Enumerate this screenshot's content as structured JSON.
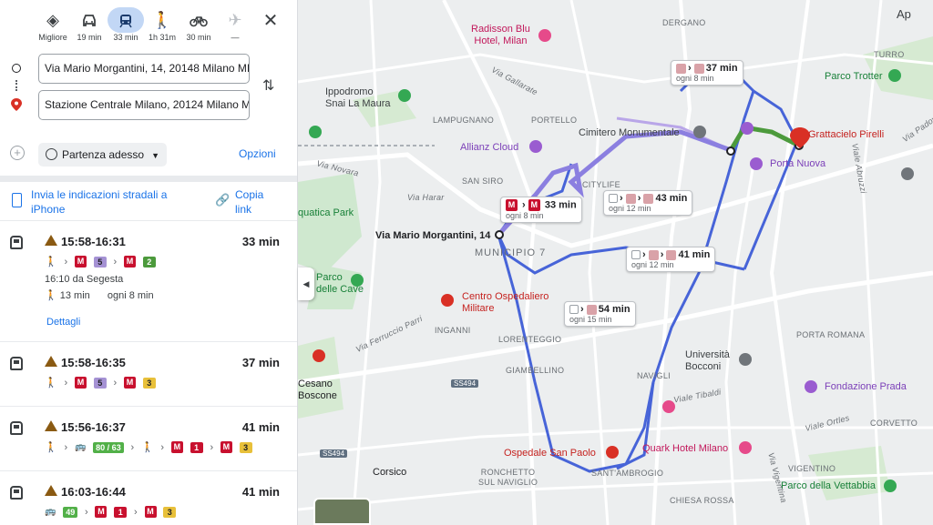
{
  "modes": [
    {
      "id": "best",
      "label": "Migliore",
      "icon": "diamond-turn-icon"
    },
    {
      "id": "car",
      "label": "19 min",
      "icon": "car-icon"
    },
    {
      "id": "transit",
      "label": "33 min",
      "icon": "train-icon",
      "active": true
    },
    {
      "id": "walk",
      "label": "1h 31m",
      "icon": "walk-icon"
    },
    {
      "id": "bike",
      "label": "30 min",
      "icon": "bike-icon"
    },
    {
      "id": "flight",
      "label": "—",
      "icon": "plane-icon"
    }
  ],
  "origin": "Via Mario Morgantini, 14, 20148 Milano MI",
  "destination": "Stazione Centrale Milano, 20124 Milano MI",
  "depart_label": "Partenza adesso",
  "options_label": "Opzioni",
  "send_label": "Invia le indicazioni stradali a iPhone",
  "copy_label": "Copia link",
  "details_label": "Dettagli",
  "routes": [
    {
      "time": "15:58-16:31",
      "duration": "33 min",
      "lines": [
        "5",
        "2"
      ],
      "info1": "16:10 da Segesta",
      "walk_time": "13 min",
      "freq": "ogni 8 min"
    },
    {
      "time": "15:58-16:35",
      "duration": "37 min",
      "lines": [
        "5",
        "3"
      ]
    },
    {
      "time": "15:56-16:37",
      "duration": "41 min",
      "bus": "80 / 63",
      "lines": [
        "1",
        "3"
      ]
    },
    {
      "time": "16:03-16:44",
      "duration": "41 min",
      "bus": "49",
      "lines": [
        "1",
        "3"
      ]
    }
  ],
  "map": {
    "origin_label": "Via Mario Morgantini, 14",
    "districts": {
      "dergano": "DERGANO",
      "turro": "TURRO",
      "lampugnano": "LAMPUGNANO",
      "portello": "PORTELLO",
      "san_siro": "SAN SIRO",
      "citylife": "CITYLIFE",
      "municipio": "MUNICIPIO 7",
      "inganni": "INGANNI",
      "lorenteggio": "LORENTEGGIO",
      "giambellino": "GIAMBELLINO",
      "navigli": "NAVIGLI",
      "porta_romana": "PORTA ROMANA",
      "corvetto": "CORVETTO",
      "ronchetto": "RONCHETTO\nSUL NAVIGLIO",
      "santambrogio": "SANT'AMBROGIO",
      "chiesa_rossa": "CHIESA ROSSA",
      "vigentino": "VIGENTINO"
    },
    "towns": {
      "corsico": "Corsico",
      "cesano": "Cesano\nBoscone"
    },
    "pois": {
      "radisson": "Radisson Blu\nHotel, Milan",
      "ippodromo": "Ippodromo\nSnai La Maura",
      "allianz": "Allianz Cloud",
      "cimitero": "Cimitero Monumentale",
      "pirelli": "Grattacielo Pirelli",
      "porta_nuova": "Porta Nuova",
      "parco_trotter": "Parco Trotter",
      "aquatica": "quatica Park",
      "parco_cave": "Parco\ndelle Cave",
      "ospedaliero": "Centro Ospedaliero\nMilitare",
      "bocconi": "Università\nBocconi",
      "fondazione": "Fondazione Prada",
      "ospedale_sp": "Ospedale San Paolo",
      "quark": "Quark Hotel Milano",
      "vettabbia": "Parco della Vettabbia"
    },
    "streets": {
      "gallarate": "Via Gallarate",
      "novara": "Via Novara",
      "harar": "Via Harar",
      "parri": "Via Ferruccio Parri",
      "tibaldi": "Viale Tibaldi",
      "ortles": "Viale Ortles",
      "vigentina": "Via Vigentina",
      "padova": "Via Padova",
      "abruzzi": "Viale Abruzzi"
    },
    "shields": {
      "ss494a": "SS494",
      "ss494b": "SS494"
    },
    "apps_label": "Ap",
    "tags": [
      {
        "dur": "33 min",
        "freq": "ogni 8 min"
      },
      {
        "dur": "37 min",
        "freq": "ogni 8 min"
      },
      {
        "dur": "43 min",
        "freq": "ogni 12 min"
      },
      {
        "dur": "41 min",
        "freq": "ogni 12 min"
      },
      {
        "dur": "54 min",
        "freq": "ogni 15 min"
      }
    ]
  },
  "colors": {
    "accent": "#1a73e8",
    "route": "#4764d8",
    "alt_route": "#8b7fe0",
    "metro": "#c8102e",
    "line5": "#a592d4",
    "line2": "#4c9a3c",
    "line3": "#e8c03a",
    "bus_green": "#52b048"
  }
}
